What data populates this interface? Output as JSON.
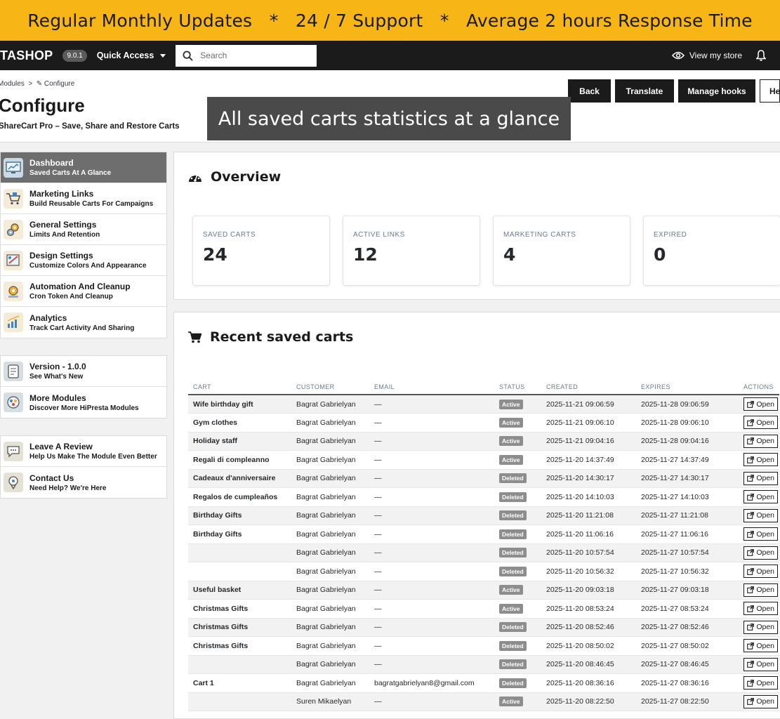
{
  "banner": {
    "text": "Regular Monthly Updates   *   24 / 7 Support   *   Average 2 hours Response Time"
  },
  "topbar": {
    "brand": "TASHOP",
    "version": "9.0.1",
    "quick_access": "Quick Access",
    "search_placeholder": "Search",
    "view_store": "View my store"
  },
  "header": {
    "breadcrumb": "Modules  >  ✎ Configure",
    "title": "Configure",
    "subtitle": "ShareCart Pro – Save, Share and Restore Carts",
    "buttons": {
      "back": "Back",
      "translate": "Translate",
      "manage_hooks": "Manage hooks",
      "help": "He"
    },
    "overlay": "All saved carts statistics at a glance"
  },
  "sidebar": {
    "group1": [
      {
        "title": "Dashboard",
        "sub": "Saved Carts At A Glance",
        "icon": "dashboard-icon"
      },
      {
        "title": "Marketing Links",
        "sub": "Build Reusable Carts For Campaigns",
        "icon": "cart-icon"
      },
      {
        "title": "General Settings",
        "sub": "Limits And Retention",
        "icon": "gears-icon"
      },
      {
        "title": "Design Settings",
        "sub": "Customize Colors And Appearance",
        "icon": "design-icon"
      },
      {
        "title": "Automation And Cleanup",
        "sub": "Cron Token And Cleanup",
        "icon": "automation-icon"
      },
      {
        "title": "Analytics",
        "sub": "Track Cart Activity And Sharing",
        "icon": "analytics-icon"
      }
    ],
    "group2": [
      {
        "title": "Version - 1.0.0",
        "sub": "See What's New",
        "icon": "document-icon"
      },
      {
        "title": "More Modules",
        "sub": "Discover More HiPresta Modules",
        "icon": "modules-icon"
      }
    ],
    "group3": [
      {
        "title": "Leave A Review",
        "sub": "Help Us Make The Module Even Better",
        "icon": "review-icon"
      },
      {
        "title": "Contact Us",
        "sub": "Need Help? We're Here",
        "icon": "contact-icon"
      }
    ]
  },
  "overview": {
    "title": "Overview",
    "stats": [
      {
        "label": "SAVED CARTS",
        "value": "24"
      },
      {
        "label": "ACTIVE LINKS",
        "value": "12"
      },
      {
        "label": "MARKETING CARTS",
        "value": "4"
      },
      {
        "label": "EXPIRED",
        "value": "0"
      }
    ]
  },
  "recent": {
    "title": "Recent saved carts",
    "columns": [
      "CART",
      "CUSTOMER",
      "EMAIL",
      "STATUS",
      "CREATED",
      "EXPIRES",
      "ACTIONS"
    ],
    "open_label": "Open",
    "rows": [
      {
        "cart": "Wife birthday gift",
        "customer": "Bagrat Gabrielyan",
        "email": "—",
        "status": "Active",
        "created": "2025-11-21 09:06:59",
        "expires": "2025-11-28 09:06:59"
      },
      {
        "cart": "Gym clothes",
        "customer": "Bagrat Gabrielyan",
        "email": "—",
        "status": "Active",
        "created": "2025-11-21 09:06:10",
        "expires": "2025-11-28 09:06:10"
      },
      {
        "cart": "Holiday staff",
        "customer": "Bagrat Gabrielyan",
        "email": "—",
        "status": "Active",
        "created": "2025-11-21 09:04:16",
        "expires": "2025-11-28 09:04:16"
      },
      {
        "cart": "Regali di compleanno",
        "customer": "Bagrat Gabrielyan",
        "email": "—",
        "status": "Active",
        "created": "2025-11-20 14:37:49",
        "expires": "2025-11-27 14:37:49"
      },
      {
        "cart": "Cadeaux d'anniversaire",
        "customer": "Bagrat Gabrielyan",
        "email": "—",
        "status": "Deleted",
        "created": "2025-11-20 14:30:17",
        "expires": "2025-11-27 14:30:17"
      },
      {
        "cart": "Regalos de cumpleaños",
        "customer": "Bagrat Gabrielyan",
        "email": "—",
        "status": "Deleted",
        "created": "2025-11-20 14:10:03",
        "expires": "2025-11-27 14:10:03"
      },
      {
        "cart": "Birthday Gifts",
        "customer": "Bagrat Gabrielyan",
        "email": "—",
        "status": "Deleted",
        "created": "2025-11-20 11:21:08",
        "expires": "2025-11-27 11:21:08"
      },
      {
        "cart": "Birthday Gifts",
        "customer": "Bagrat Gabrielyan",
        "email": "—",
        "status": "Deleted",
        "created": "2025-11-20 11:06:16",
        "expires": "2025-11-27 11:06:16"
      },
      {
        "cart": "",
        "customer": "Bagrat Gabrielyan",
        "email": "—",
        "status": "Deleted",
        "created": "2025-11-20 10:57:54",
        "expires": "2025-11-27 10:57:54"
      },
      {
        "cart": "",
        "customer": "Bagrat Gabrielyan",
        "email": "—",
        "status": "Deleted",
        "created": "2025-11-20 10:56:32",
        "expires": "2025-11-27 10:56:32"
      },
      {
        "cart": "Useful basket",
        "customer": "Bagrat Gabrielyan",
        "email": "—",
        "status": "Active",
        "created": "2025-11-20 09:03:18",
        "expires": "2025-11-27 09:03:18"
      },
      {
        "cart": "Christmas Gifts",
        "customer": "Bagrat Gabrielyan",
        "email": "—",
        "status": "Active",
        "created": "2025-11-20 08:53:24",
        "expires": "2025-11-27 08:53:24"
      },
      {
        "cart": "Christmas Gifts",
        "customer": "Bagrat Gabrielyan",
        "email": "—",
        "status": "Deleted",
        "created": "2025-11-20 08:52:46",
        "expires": "2025-11-27 08:52:46"
      },
      {
        "cart": "Christmas Gifts",
        "customer": "Bagrat Gabrielyan",
        "email": "—",
        "status": "Deleted",
        "created": "2025-11-20 08:50:02",
        "expires": "2025-11-27 08:50:02"
      },
      {
        "cart": "",
        "customer": "Bagrat Gabrielyan",
        "email": "—",
        "status": "Deleted",
        "created": "2025-11-20 08:46:45",
        "expires": "2025-11-27 08:46:45"
      },
      {
        "cart": "Cart 1",
        "customer": "Bagrat Gabrielyan",
        "email": "bagratgabrielyan8@gmail.com",
        "status": "Deleted",
        "created": "2025-11-20 08:36:16",
        "expires": "2025-11-27 08:36:16"
      },
      {
        "cart": "",
        "customer": "Suren Mikaelyan",
        "email": "—",
        "status": "Active",
        "created": "2025-11-20 08:22:50",
        "expires": "2025-11-27 08:22:50"
      }
    ]
  },
  "colors": {
    "banner": "#f7b516",
    "topbar": "#1b1b1b",
    "active_sidebar": "#6e6e6e",
    "badge": "#8d8d8d"
  }
}
